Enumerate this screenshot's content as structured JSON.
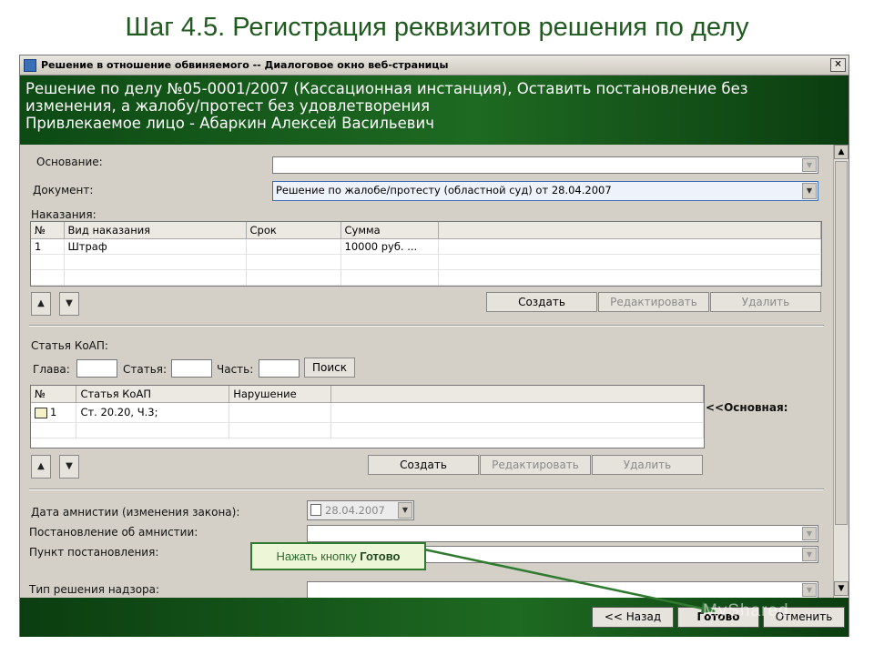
{
  "slide": {
    "title": "Шаг 4.5. Регистрация реквизитов решения по делу"
  },
  "window": {
    "title": "Решение в отношение обвиняемого -- Диалоговое окно веб-страницы",
    "close_glyph": "×"
  },
  "header": {
    "line1": "Решение по делу №05-0001/2007 (Кассационная инстанция), Оставить постановление без",
    "line2": "изменения, а жалобу/протест без удовлетворения",
    "line3": "Привлекаемое лицо - Абаркин Алексей Васильевич"
  },
  "form": {
    "osnovanie_label": "Основание:",
    "osnovanie_value": "",
    "document_label": "Документ:",
    "document_value": "Решение по жалобе/протесту (областной суд) от 28.04.2007",
    "nakazaniya_label": "Наказания:",
    "nakazaniya": {
      "headers": [
        "№",
        "Вид наказания",
        "Срок",
        "Сумма"
      ],
      "rows": [
        [
          "1",
          "Штраф",
          "",
          "10000 руб. ..."
        ]
      ]
    },
    "buttons1": {
      "create": "Создать",
      "edit": "Редактировать",
      "delete": "Удалить"
    },
    "koap_label": "Статья КоАП:",
    "glava_label": "Глава:",
    "statya_label": "Статья:",
    "chast_label": "Часть:",
    "search_button": "Поиск",
    "koap": {
      "headers": [
        "№",
        "Статья КоАП",
        "Нарушение"
      ],
      "rows": [
        [
          "1",
          "Ст. 20.20, Ч.3;",
          ""
        ]
      ]
    },
    "osnovnaya_label": "<<Основная:",
    "buttons2": {
      "create": "Создать",
      "edit": "Редактировать",
      "delete": "Удалить"
    },
    "amnesty_date_label": "Дата амнистии (изменения закона):",
    "amnesty_date_value": "28.04.2007",
    "amnesty_decree_label": "Постановление об амнистии:",
    "decree_point_label": "Пункт постановления:",
    "decision_type_label": "Тип решения надзора:"
  },
  "footer": {
    "back": "<< Назад",
    "done": "Готово",
    "cancel": "Отменить"
  },
  "callout": {
    "prefix": "Нажать кнопку ",
    "bold": "Готово"
  },
  "watermark": "MyShared",
  "icons": {
    "up": "▲",
    "down": "▼",
    "dropdown": "▼"
  }
}
